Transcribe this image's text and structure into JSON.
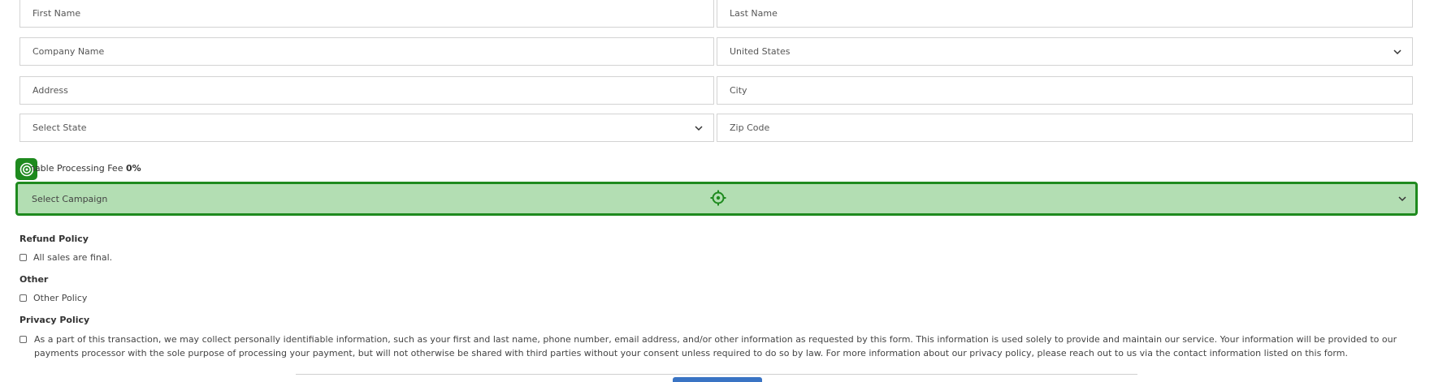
{
  "form": {
    "first_name": {
      "placeholder": "First Name"
    },
    "last_name": {
      "placeholder": "Last Name"
    },
    "company_name": {
      "placeholder": "Company Name"
    },
    "country": {
      "value": "United States"
    },
    "address": {
      "placeholder": "Address"
    },
    "city": {
      "placeholder": "City"
    },
    "state": {
      "value": "Select State"
    },
    "zip": {
      "placeholder": "Zip Code"
    },
    "processing_fee": {
      "label": "Enable Processing Fee",
      "value": "0%"
    },
    "campaign": {
      "value": "Select Campaign"
    }
  },
  "policies": {
    "refund": {
      "title": "Refund Policy",
      "text": "All sales are final."
    },
    "other": {
      "title": "Other",
      "text": "Other Policy"
    },
    "privacy": {
      "title": "Privacy Policy",
      "text": "As a part of this transaction, we may collect personally identifiable information, such as your first and last name, phone number, email address, and/or other information as requested by this form. This information is used solely to provide and maintain our service. Your information will be provided to our payments processor with the sole purpose of processing your payment, but will not otherwise be shared with third parties without your consent unless required to do so by law. For more information about our privacy policy, please reach out to us via the contact information listed on this form."
    }
  },
  "icons": {
    "chevron": "chevron-down-icon",
    "target": "crosshair-icon",
    "badge": "target-icon"
  },
  "colors": {
    "highlight_fill": "#b3deb3",
    "highlight_border": "#1e8a1e",
    "submit_button": "#3a74c4"
  }
}
